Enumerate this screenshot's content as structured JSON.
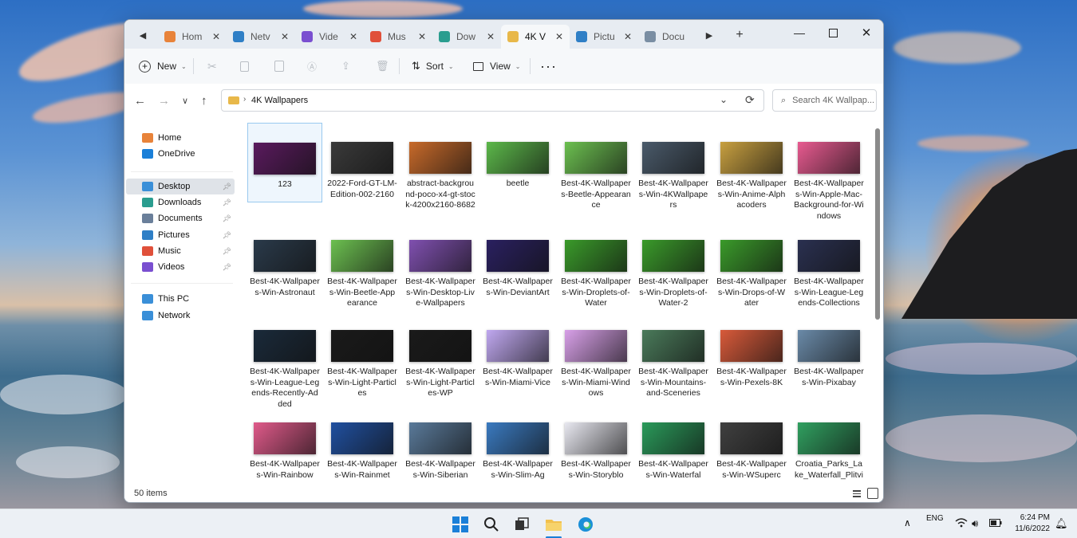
{
  "explorer": {
    "tabs": [
      {
        "label": "Hom",
        "icon": "home-icon",
        "color": "#e8833a"
      },
      {
        "label": "Netv",
        "icon": "network-icon",
        "color": "#2f7fc6"
      },
      {
        "label": "Vide",
        "icon": "videos-icon",
        "color": "#7a4fd0"
      },
      {
        "label": "Mus",
        "icon": "music-icon",
        "color": "#e0503a"
      },
      {
        "label": "Dow",
        "icon": "downloads-icon",
        "color": "#2a9d8f"
      },
      {
        "label": "4K V",
        "icon": "folder-icon",
        "color": "#e8b84a"
      },
      {
        "label": "Pictu",
        "icon": "pictures-icon",
        "color": "#2f7fc6"
      },
      {
        "label": "Docu",
        "icon": "documents-icon",
        "color": "#7a8ea3"
      }
    ],
    "toolbar": {
      "new_label": "New",
      "sort_label": "Sort",
      "view_label": "View"
    },
    "address": {
      "path": "4K Wallpapers",
      "search_placeholder": "Search 4K Wallpap..."
    },
    "sidebar": {
      "items": [
        {
          "label": "Home",
          "icon": "home-icon"
        },
        {
          "label": "OneDrive",
          "icon": "onedrive-icon"
        },
        {
          "label": "Desktop",
          "icon": "desktop-icon"
        },
        {
          "label": "Downloads",
          "icon": "downloads-icon"
        },
        {
          "label": "Documents",
          "icon": "documents-icon"
        },
        {
          "label": "Pictures",
          "icon": "pictures-icon"
        },
        {
          "label": "Music",
          "icon": "music-icon"
        },
        {
          "label": "Videos",
          "icon": "videos-icon"
        },
        {
          "label": "This PC",
          "icon": "this-pc-icon"
        },
        {
          "label": "Network",
          "icon": "network-icon"
        }
      ]
    },
    "files": [
      "123",
      "2022-Ford-GT-LM-Edition-002-2160",
      "abstract-background-poco-x4-gt-stock-4200x2160-8682",
      "beetle",
      "Best-4K-Wallpapers-Beetle-Appearance",
      "Best-4K-Wallpapers-Win-4KWallpapers",
      "Best-4K-Wallpapers-Win-Anime-Alphacoders",
      "Best-4K-Wallpapers-Win-Apple-Mac-Background-for-Windows",
      "Best-4K-Wallpapers-Win-Astronaut",
      "Best-4K-Wallpapers-Win-Beetle-Appearance",
      "Best-4K-Wallpapers-Win-Desktop-Live-Wallpapers",
      "Best-4K-Wallpapers-Win-DeviantArt",
      "Best-4K-Wallpapers-Win-Droplets-of-Water",
      "Best-4K-Wallpapers-Win-Droplets-of-Water-2",
      "Best-4K-Wallpapers-Win-Drops-of-Water",
      "Best-4K-Wallpapers-Win-League-Legends-Collections",
      "Best-4K-Wallpapers-Win-League-Legends-Recently-Added",
      "Best-4K-Wallpapers-Win-Light-Particles",
      "Best-4K-Wallpapers-Win-Light-Particles-WP",
      "Best-4K-Wallpapers-Win-Miami-Vice",
      "Best-4K-Wallpapers-Win-Miami-Windows",
      "Best-4K-Wallpapers-Win-Mountains-and-Sceneries",
      "Best-4K-Wallpapers-Win-Pexels-8K",
      "Best-4K-Wallpapers-Win-Pixabay",
      "Best-4K-Wallpapers-Win-Rainbow",
      "Best-4K-Wallpapers-Win-Rainmet",
      "Best-4K-Wallpapers-Win-Siberian",
      "Best-4K-Wallpapers-Win-Slim-Ag",
      "Best-4K-Wallpapers-Win-Storyblo",
      "Best-4K-Wallpapers-Win-Waterfal",
      "Best-4K-Wallpapers-Win-WSuperc",
      "Croatia_Parks_Lake_Waterfall_Plitvi"
    ],
    "thumb_colors": [
      "#5a1a5e",
      "#3a3a3a",
      "#c86a2a",
      "#5cb84a",
      "#6cc050",
      "#4a5a6a",
      "#c8a040",
      "#e85a90",
      "#2a3a4a",
      "#6cc050",
      "#8050b0",
      "#2a2060",
      "#3a9a2a",
      "#3a9a2a",
      "#3a9a2a",
      "#2a3050",
      "#1a2a3a",
      "#1a1a1a",
      "#1a1a1a",
      "#c0a8f0",
      "#d8a0e8",
      "#4a7a5a",
      "#d85a3a",
      "#6a8aa8",
      "#e05a8a",
      "#2050a0",
      "#5a7a9a",
      "#3a7ac0",
      "#e8e8f0",
      "#2a9a5a",
      "#404040",
      "#30a060"
    ],
    "status_items": "50 items"
  },
  "taskbar": {
    "apps": [
      "start-icon",
      "search-icon",
      "task-view-icon",
      "file-explorer-icon",
      "edge-icon"
    ],
    "lang": "ENG",
    "time": "6:24 PM",
    "date": "11/6/2022"
  }
}
